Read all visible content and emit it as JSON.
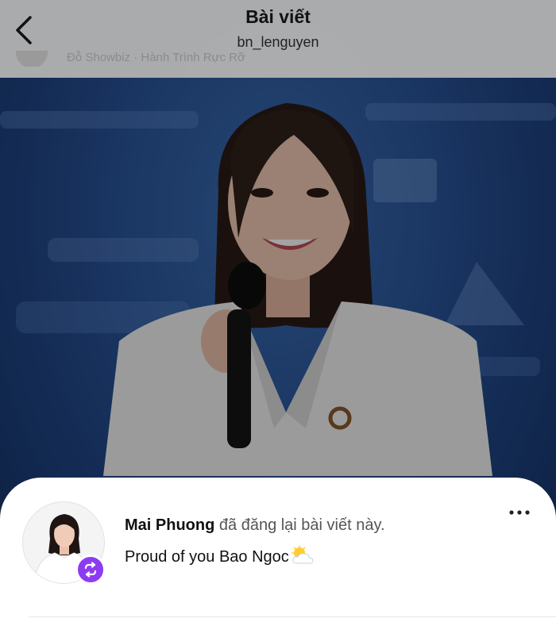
{
  "header": {
    "title": "Bài viết",
    "username": "bn_lenguyen",
    "behind_text": "Đỗ Showbiz · Hành Trình Rực Rỡ"
  },
  "photo": {
    "description_icon": "woman-speaking-at-microphone"
  },
  "repost": {
    "name": "Mai Phuong",
    "action_text": "đã đăng lại bài viết này.",
    "message": "Proud of you Bao Ngoc",
    "emoji": "sun-behind-cloud-icon",
    "badge_color": "#8e3bf0"
  },
  "colors": {
    "header_bg": "#b0b0b0",
    "card_bg": "#ffffff",
    "stage_blue": "#2a559b"
  }
}
